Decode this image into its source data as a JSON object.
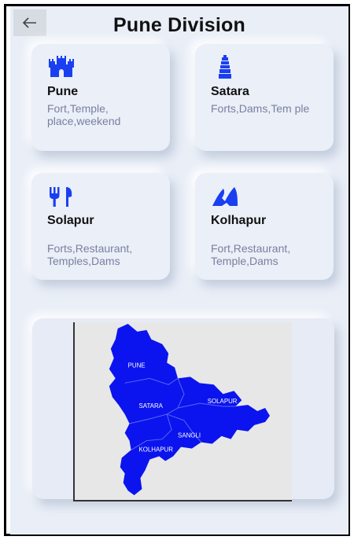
{
  "header": {
    "title": "Pune Division",
    "back_icon": "arrow-left-icon"
  },
  "cards": [
    {
      "name": "Pune",
      "desc": "Fort,Temple, place,weekend",
      "icon": "castle-icon"
    },
    {
      "name": "Satara",
      "desc": "Forts,Dams,Tem ple",
      "icon": "temple-icon"
    },
    {
      "name": "Solapur",
      "desc": "Forts,Restaurant, Temples,Dams",
      "icon": "fork-knife-icon"
    },
    {
      "name": "Kolhapur",
      "desc": "Fort,Restaurant, Temple,Dams",
      "icon": "mountain-icon"
    }
  ],
  "map": {
    "labels": {
      "pune": "PUNE",
      "satara": "SATARA",
      "solapur": "SOLAPUR",
      "sangli": "SANGLI",
      "kolhapur": "KOLHAPUR"
    },
    "fill_color": "#0b14ee"
  },
  "colors": {
    "accent": "#1a3ff0",
    "background": "#e9eef7"
  }
}
